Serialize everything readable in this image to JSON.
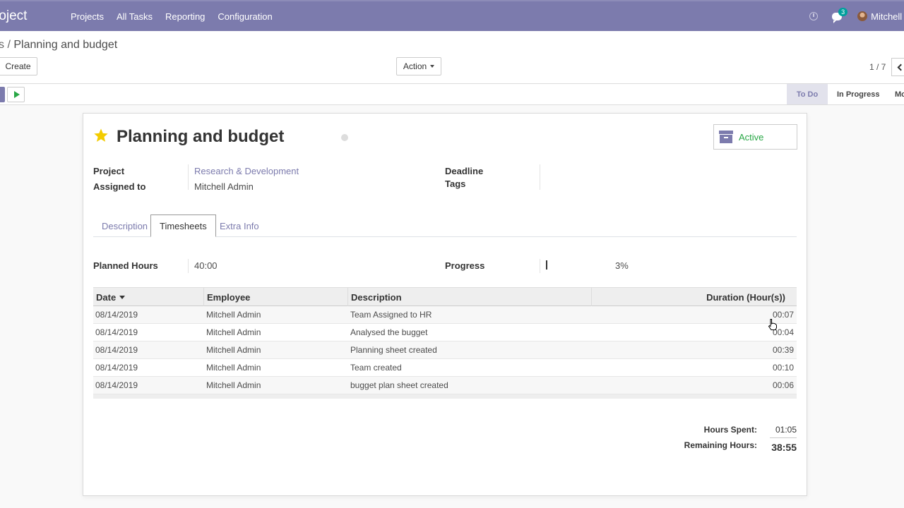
{
  "navbar": {
    "brand": "roject",
    "menu": [
      "Projects",
      "All Tasks",
      "Reporting",
      "Configuration"
    ],
    "chat_count": "3",
    "user": "Mitchell Ad"
  },
  "control": {
    "breadcrumb_prev": "s",
    "breadcrumb_sep": "/",
    "breadcrumb_current": "Planning and budget",
    "create_label": "Create",
    "action_label": "Action",
    "pager": "1 / 7"
  },
  "stages": [
    "To Do",
    "In Progress",
    "Mo"
  ],
  "task": {
    "title": "Planning and budget",
    "active_label": "Active",
    "project_label": "Project",
    "project_value": "Research & Development",
    "assigned_label": "Assigned to",
    "assigned_value": "Mitchell Admin",
    "deadline_label": "Deadline",
    "tags_label": "Tags",
    "tabs": [
      "Description",
      "Timesheets",
      "Extra Info"
    ],
    "planned_hours_label": "Planned Hours",
    "planned_hours_value": "40:00",
    "progress_label": "Progress",
    "progress_value": "3%"
  },
  "timesheet": {
    "headers": [
      "Date",
      "Employee",
      "Description",
      "Duration (Hour(s))"
    ],
    "rows": [
      [
        "08/14/2019",
        "Mitchell Admin",
        "Team Assigned to HR",
        "00:07"
      ],
      [
        "08/14/2019",
        "Mitchell Admin",
        "Analysed the bugget",
        "00:04"
      ],
      [
        "08/14/2019",
        "Mitchell Admin",
        "Planning sheet created",
        "00:39"
      ],
      [
        "08/14/2019",
        "Mitchell Admin",
        "Team created",
        "00:10"
      ],
      [
        "08/14/2019",
        "Mitchell Admin",
        "bugget plan sheet created",
        "00:06"
      ]
    ]
  },
  "totals": {
    "hours_spent_label": "Hours Spent:",
    "hours_spent_value": "01:05",
    "remaining_label": "Remaining Hours:",
    "remaining_value": "38:55"
  },
  "colors": {
    "brand": "#7c7bad",
    "active": "#28a745",
    "star": "#f3cc00"
  }
}
